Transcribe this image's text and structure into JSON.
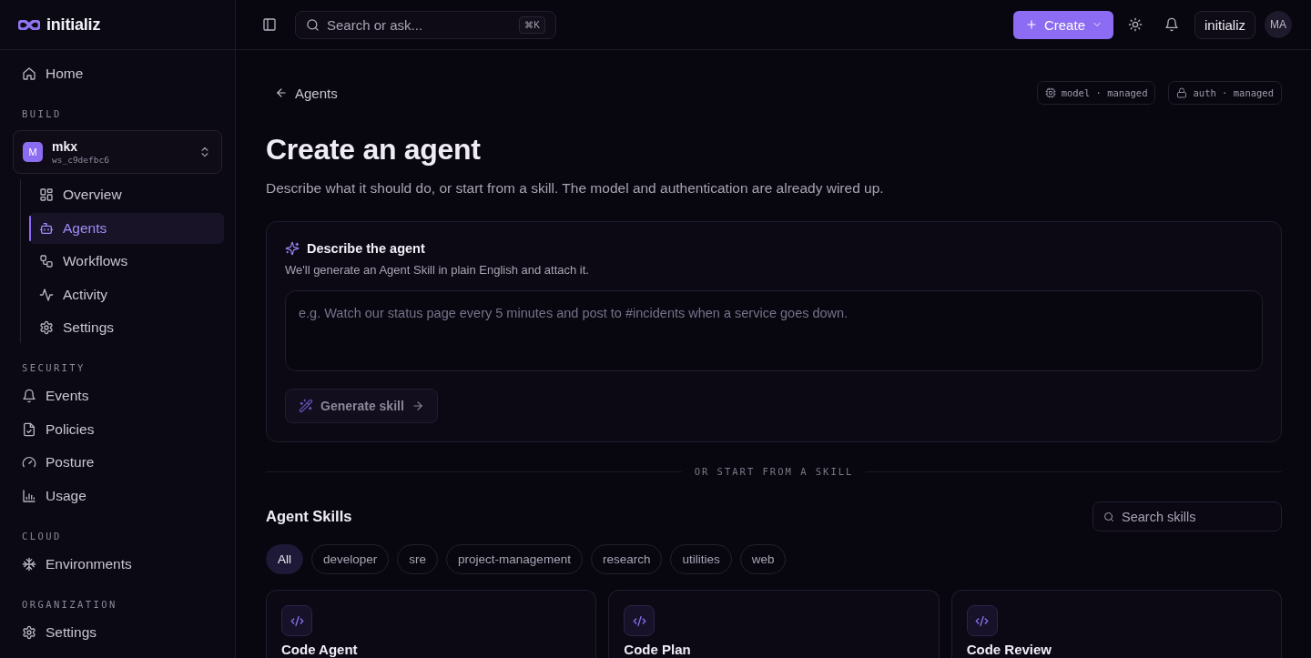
{
  "sidebar": {
    "brand": "initializ",
    "groups": [
      {
        "items": [
          {
            "label": "Home",
            "selected": false
          }
        ]
      },
      {
        "heading": "BUILD",
        "workspace": {
          "initial": "M",
          "name": "mkx",
          "id": "ws_c9defbc6"
        },
        "items": [
          {
            "label": "Overview",
            "selected": false
          },
          {
            "label": "Agents",
            "selected": true
          },
          {
            "label": "Workflows",
            "selected": false
          },
          {
            "label": "Activity",
            "selected": false
          },
          {
            "label": "Settings",
            "selected": false
          }
        ]
      },
      {
        "heading": "SECURITY",
        "items": [
          {
            "label": "Events",
            "selected": false
          },
          {
            "label": "Policies",
            "selected": false
          },
          {
            "label": "Posture",
            "selected": false
          },
          {
            "label": "Usage",
            "selected": false
          }
        ]
      },
      {
        "heading": "CLOUD",
        "items": [
          {
            "label": "Environments",
            "selected": false
          }
        ]
      },
      {
        "heading": "ORGANIZATION",
        "items": [
          {
            "label": "Settings",
            "selected": false
          }
        ]
      }
    ]
  },
  "topbar": {
    "search": {
      "placeholder": "Search or ask...",
      "shortcut": "⌘K"
    },
    "create_button": "Create",
    "workspace_button": "initializ",
    "avatar": "MA"
  },
  "page": {
    "back_link": "Agents",
    "badges": [
      "model · managed",
      "auth · managed"
    ],
    "title": "Create an agent",
    "subtitle": "Describe what it should do, or start from a skill. The model and authentication are already wired up."
  },
  "describe": {
    "title": "Describe the agent",
    "hint": "We'll generate an Agent Skill in plain English and attach it.",
    "input": {
      "placeholder": "e.g. Watch our status page every 5 minutes and post to #incidents when a service goes down."
    },
    "button": {
      "label": "Generate skill",
      "disabled": true
    }
  },
  "divider": "OR START FROM A SKILL",
  "skills": {
    "title": "Agent Skills",
    "search": {
      "placeholder": "Search skills"
    },
    "filters": [
      {
        "label": "All",
        "selected": true
      },
      {
        "label": "developer",
        "selected": false
      },
      {
        "label": "sre",
        "selected": false
      },
      {
        "label": "project-management",
        "selected": false
      },
      {
        "label": "research",
        "selected": false
      },
      {
        "label": "utilities",
        "selected": false
      },
      {
        "label": "web",
        "selected": false
      }
    ],
    "cards": [
      {
        "title": "Code Agent"
      },
      {
        "title": "Code Plan"
      },
      {
        "title": "Code Review"
      }
    ]
  }
}
